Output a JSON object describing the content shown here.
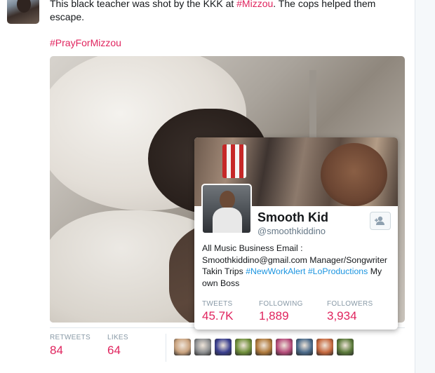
{
  "tweet": {
    "text_before": "This black teacher was shot by the KKK at ",
    "text_hashtag": "#Mizzou",
    "text_after": ". The cops helped them escape.",
    "hashtag_line": "#PrayForMizzou"
  },
  "hovercard": {
    "name": "Smooth Kid",
    "handle": "@smoothkiddino",
    "bio_line1": "All Music Business Email : Smoothkiddino@gmail.com Manager/Songwriter Takin Trips ",
    "bio_tag1": "#NewWorkAlert",
    "bio_space": " ",
    "bio_tag2": "#LoProductions",
    "bio_end": " My own Boss",
    "stats": {
      "tweets_label": "TWEETS",
      "tweets_value": "45.7K",
      "following_label": "FOLLOWING",
      "following_value": "1,889",
      "followers_label": "FOLLOWERS",
      "followers_value": "3,934"
    },
    "follow_icon": "add-user-icon"
  },
  "engagement": {
    "retweets_label": "RETWEETS",
    "retweets_value": "84",
    "likes_label": "LIKES",
    "likes_value": "64"
  },
  "likers": [
    {
      "name": "liker-avatar-1",
      "color": "#c9a27e"
    },
    {
      "name": "liker-avatar-2",
      "color": "#8d8f91"
    },
    {
      "name": "liker-avatar-3",
      "color": "#3a3f8f"
    },
    {
      "name": "liker-avatar-4",
      "color": "#6f8f3a"
    },
    {
      "name": "liker-avatar-5",
      "color": "#b07a3c"
    },
    {
      "name": "liker-avatar-6",
      "color": "#b54b7a"
    },
    {
      "name": "liker-avatar-7",
      "color": "#4a6a8a"
    },
    {
      "name": "liker-avatar-8",
      "color": "#c6683e"
    },
    {
      "name": "liker-avatar-9",
      "color": "#5b7a3a"
    }
  ],
  "colors": {
    "accent": "#e0245e",
    "link": "#1b95e0",
    "muted": "#8899a6"
  }
}
